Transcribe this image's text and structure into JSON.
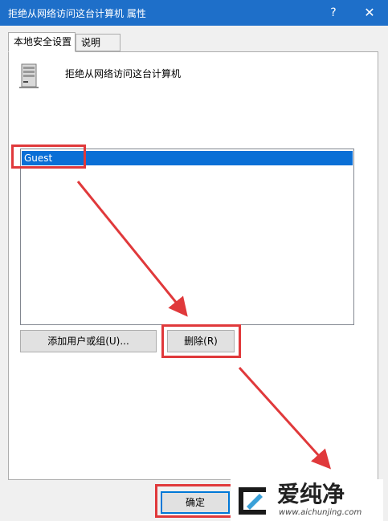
{
  "window": {
    "title": "拒绝从网络访问这台计算机 属性",
    "help_glyph": "?",
    "close_glyph": "✕"
  },
  "tabs": [
    {
      "label": "本地安全设置",
      "active": true
    },
    {
      "label": "说明",
      "active": false
    }
  ],
  "policy": {
    "icon": "server-icon",
    "title": "拒绝从网络访问这台计算机"
  },
  "accounts_list": {
    "items": [
      {
        "label": "Guest",
        "selected": true
      }
    ]
  },
  "buttons": {
    "add": "添加用户或组(U)...",
    "delete": "删除(R)",
    "ok": "确定"
  },
  "annotations": {
    "highlight_color": "#e0393b"
  },
  "watermark": {
    "name": "爱纯净",
    "url": "www.aichunjing.com"
  },
  "colors": {
    "titlebar": "#1e6fc9",
    "selection": "#0a6fd6",
    "button_face": "#e1e1e1"
  }
}
